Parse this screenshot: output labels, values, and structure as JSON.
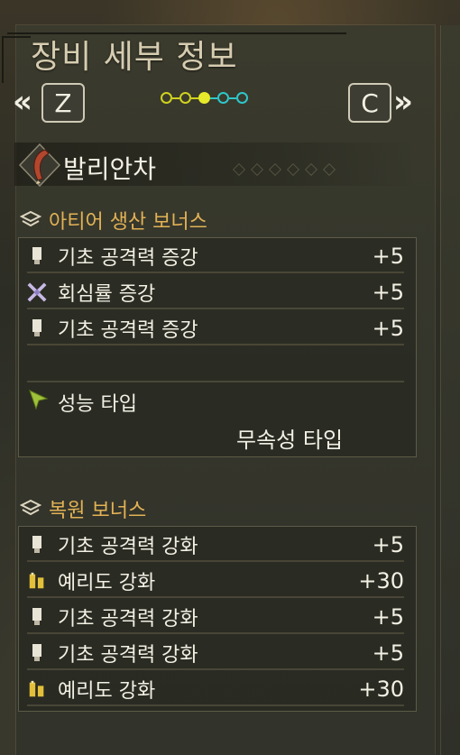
{
  "header": {
    "title": "장비 세부 정보",
    "prev_key": "Z",
    "next_key": "C",
    "prev_arrow": "«",
    "next_arrow": "»",
    "page_dots": [
      "olive",
      "olive",
      "yellow-filled",
      "cyan",
      "cyan"
    ]
  },
  "weapon": {
    "name": "발리안차",
    "icon": "weapon-icon"
  },
  "artian_bonus": {
    "title": "아티어 생산 보너스",
    "stats": [
      {
        "label": "기초 공격력 증강",
        "value": "+5",
        "icon": "attack-icon"
      },
      {
        "label": "회심률 증강",
        "value": "+5",
        "icon": "affinity-icon"
      },
      {
        "label": "기초 공격력 증강",
        "value": "+5",
        "icon": "attack-icon"
      }
    ],
    "performance_label": "성능 타입",
    "performance_value": "무속성 타입"
  },
  "restore_bonus": {
    "title": "복원 보너스",
    "stats": [
      {
        "label": "기초 공격력 강화",
        "value": "+5",
        "icon": "attack-icon"
      },
      {
        "label": "예리도 강화",
        "value": "+30",
        "icon": "sharpness-icon"
      },
      {
        "label": "기초 공격력 강화",
        "value": "+5",
        "icon": "attack-icon"
      },
      {
        "label": "기초 공격력 강화",
        "value": "+5",
        "icon": "attack-icon"
      },
      {
        "label": "예리도 강화",
        "value": "+30",
        "icon": "sharpness-icon"
      }
    ]
  },
  "colors": {
    "section_title": "#e2b255",
    "dot_yellow": "#e7ea2a",
    "dot_cyan": "#2fc6c9"
  }
}
